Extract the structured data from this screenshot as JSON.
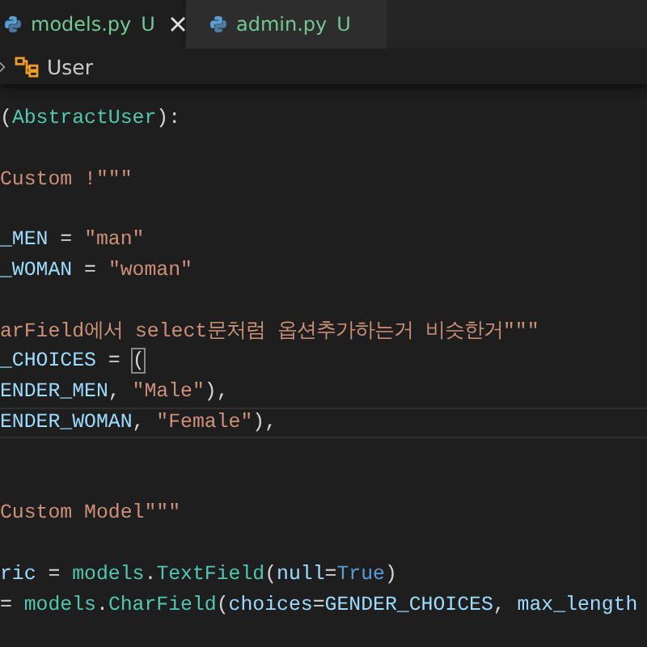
{
  "tabs": [
    {
      "label": "models.py",
      "status": "U",
      "selected": true
    },
    {
      "label": "admin.py",
      "status": "U",
      "selected": false
    }
  ],
  "breadcrumb": {
    "label": "User"
  },
  "code_lines": [
    {
      "current": false,
      "tokens": [
        {
          "kind": "plain",
          "text": "("
        },
        {
          "kind": "class",
          "text": "AbstractUser"
        },
        {
          "kind": "plain",
          "text": "):"
        }
      ]
    },
    {
      "current": false
    },
    {
      "current": false,
      "tokens": [
        {
          "kind": "string",
          "text": "Custom !\"\"\""
        }
      ]
    },
    {
      "current": false
    },
    {
      "current": false,
      "tokens": [
        {
          "kind": "variable",
          "text": "_MEN"
        },
        {
          "kind": "plain",
          "text": " = "
        },
        {
          "kind": "string",
          "text": "\"man\""
        }
      ]
    },
    {
      "current": false,
      "tokens": [
        {
          "kind": "variable",
          "text": "_WOMAN"
        },
        {
          "kind": "plain",
          "text": " = "
        },
        {
          "kind": "string",
          "text": "\"woman\""
        }
      ]
    },
    {
      "current": false
    },
    {
      "current": false,
      "tokens": [
        {
          "kind": "string",
          "text": "arField에서 select문처럼 옵션추가하는거 비슷한거\"\"\""
        }
      ]
    },
    {
      "current": false,
      "tokens": [
        {
          "kind": "variable",
          "text": "_CHOICES"
        },
        {
          "kind": "plain",
          "text": " = "
        },
        {
          "kind": "bracket-match",
          "text": "("
        }
      ]
    },
    {
      "current": false,
      "tokens": [
        {
          "kind": "variable",
          "text": "ENDER_MEN"
        },
        {
          "kind": "plain",
          "text": ", "
        },
        {
          "kind": "string",
          "text": "\"Male\""
        },
        {
          "kind": "plain",
          "text": "),"
        }
      ]
    },
    {
      "current": true,
      "tokens": [
        {
          "kind": "variable",
          "text": "ENDER_WOMAN"
        },
        {
          "kind": "plain",
          "text": ", "
        },
        {
          "kind": "string",
          "text": "\"Female\""
        },
        {
          "kind": "plain",
          "text": "),"
        }
      ]
    },
    {
      "current": false
    },
    {
      "current": false
    },
    {
      "current": false,
      "tokens": [
        {
          "kind": "string",
          "text": "Custom Model\"\"\""
        }
      ]
    },
    {
      "current": false
    },
    {
      "current": false,
      "tokens": [
        {
          "kind": "variable",
          "text": "ric"
        },
        {
          "kind": "plain",
          "text": " = "
        },
        {
          "kind": "class",
          "text": "models"
        },
        {
          "kind": "plain",
          "text": "."
        },
        {
          "kind": "class",
          "text": "TextField"
        },
        {
          "kind": "plain",
          "text": "("
        },
        {
          "kind": "variable",
          "text": "null"
        },
        {
          "kind": "plain",
          "text": "="
        },
        {
          "kind": "keyword",
          "text": "True"
        },
        {
          "kind": "plain",
          "text": ")"
        }
      ]
    },
    {
      "current": false,
      "tokens": [
        {
          "kind": "plain",
          "text": "= "
        },
        {
          "kind": "class",
          "text": "models"
        },
        {
          "kind": "plain",
          "text": "."
        },
        {
          "kind": "class",
          "text": "CharField"
        },
        {
          "kind": "plain",
          "text": "("
        },
        {
          "kind": "variable",
          "text": "choices"
        },
        {
          "kind": "plain",
          "text": "="
        },
        {
          "kind": "variable",
          "text": "GENDER_CHOICES"
        },
        {
          "kind": "plain",
          "text": ", "
        },
        {
          "kind": "variable",
          "text": "max_length"
        }
      ]
    }
  ]
}
